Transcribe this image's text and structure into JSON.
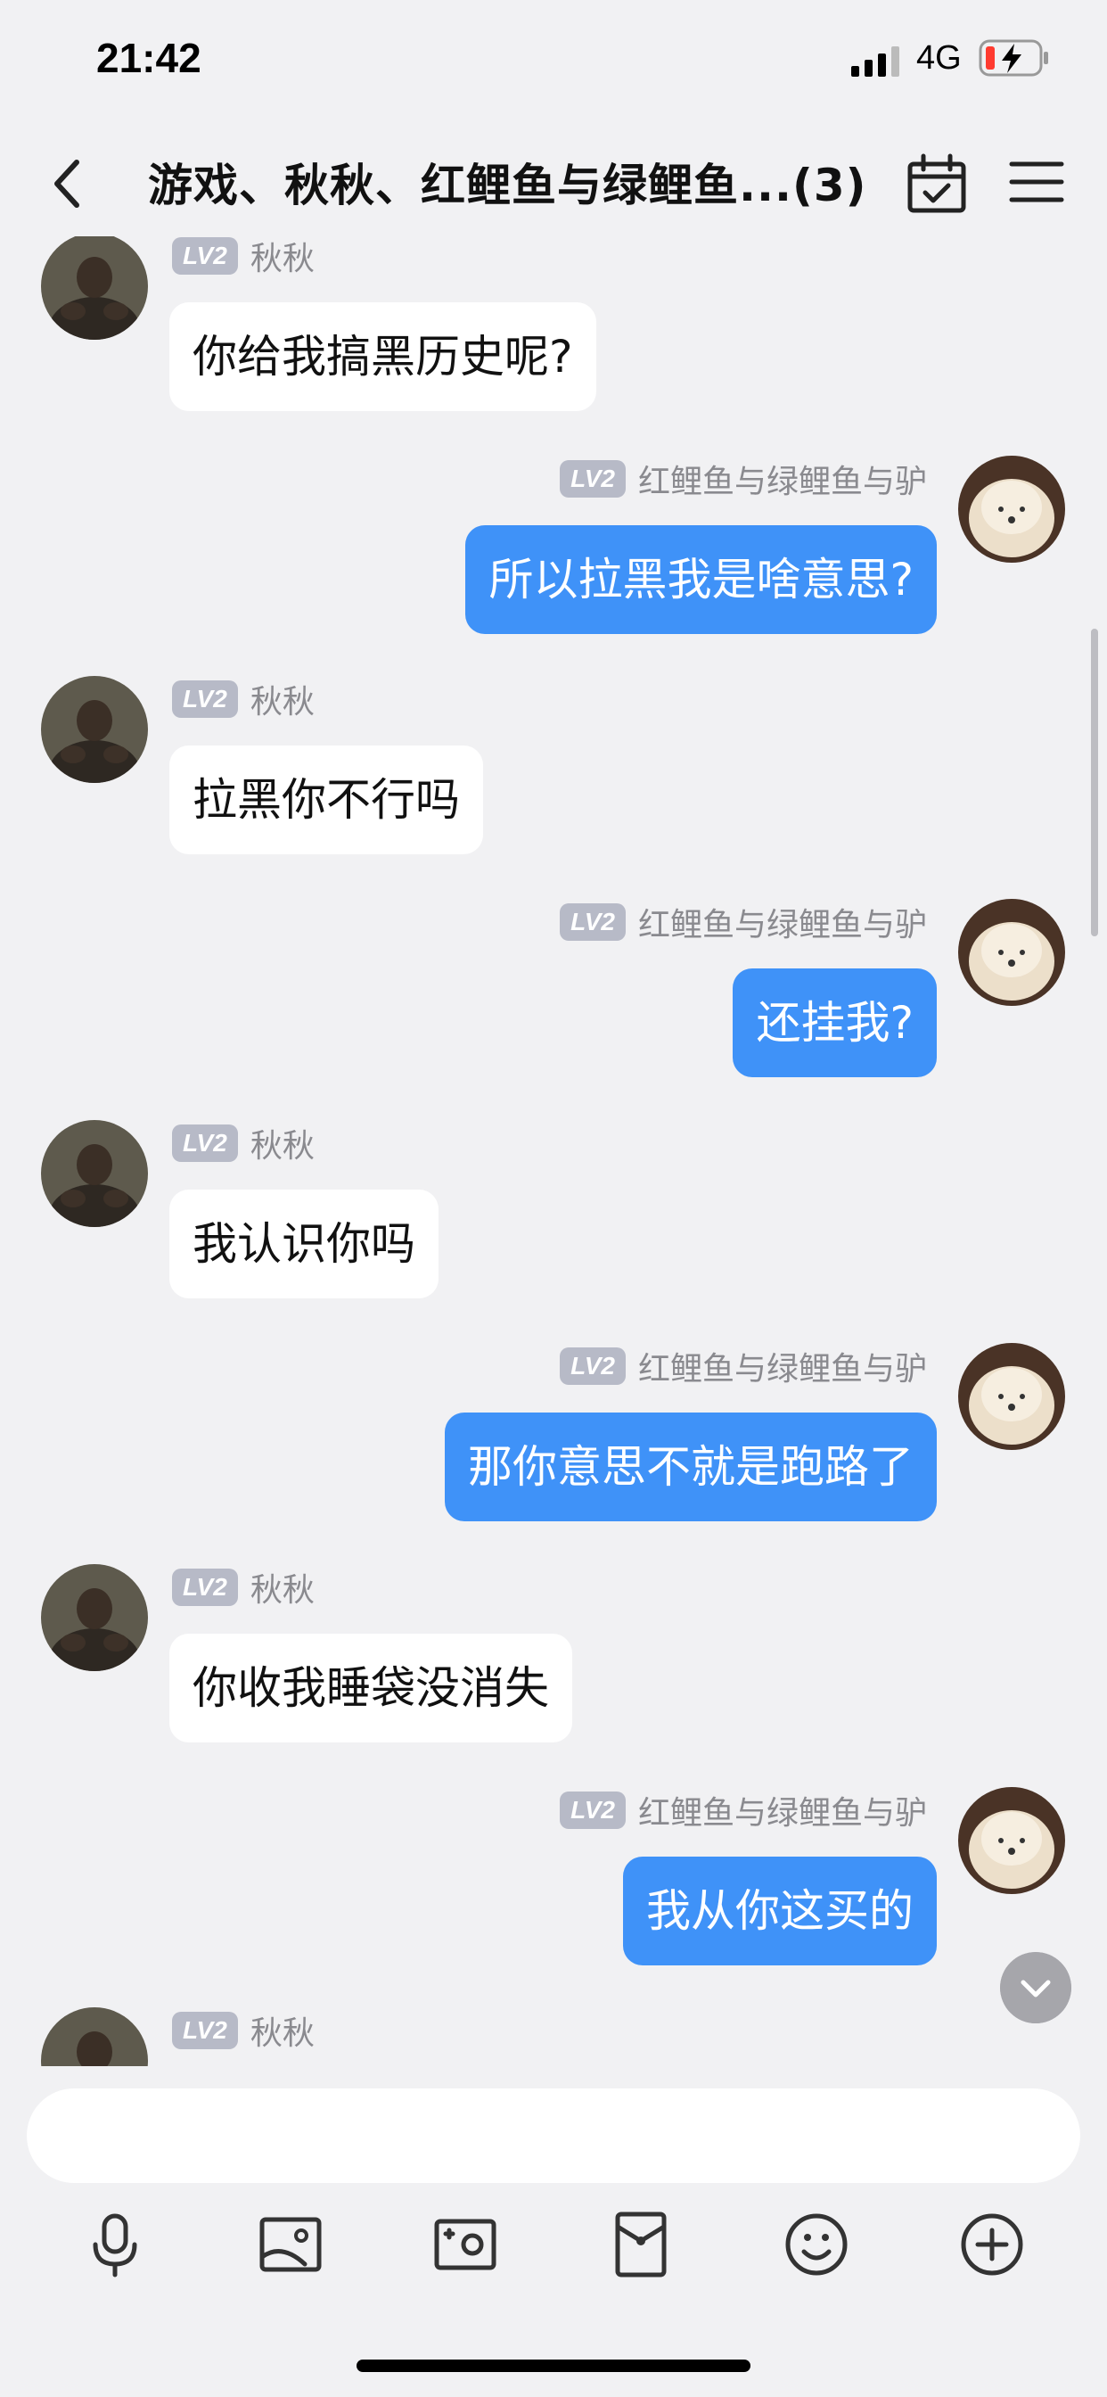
{
  "status_bar": {
    "time": "21:42",
    "network": "4G"
  },
  "header": {
    "title": "游戏、秋秋、红鲤鱼与绿鲤鱼...(3)"
  },
  "messages": [
    {
      "side": "left",
      "level": "LV2",
      "sender": "秋秋",
      "text": "你给我搞黑历史呢?"
    },
    {
      "side": "right",
      "level": "LV2",
      "sender": "红鲤鱼与绿鲤鱼与驴",
      "text": "所以拉黑我是啥意思?"
    },
    {
      "side": "left",
      "level": "LV2",
      "sender": "秋秋",
      "text": "拉黑你不行吗"
    },
    {
      "side": "right",
      "level": "LV2",
      "sender": "红鲤鱼与绿鲤鱼与驴",
      "text": "还挂我?"
    },
    {
      "side": "left",
      "level": "LV2",
      "sender": "秋秋",
      "text": "我认识你吗"
    },
    {
      "side": "right",
      "level": "LV2",
      "sender": "红鲤鱼与绿鲤鱼与驴",
      "text": "那你意思不就是跑路了"
    },
    {
      "side": "left",
      "level": "LV2",
      "sender": "秋秋",
      "text": "你收我睡袋没消失"
    },
    {
      "side": "right",
      "level": "LV2",
      "sender": "红鲤鱼与绿鲤鱼与驴",
      "text": "我从你这买的"
    },
    {
      "side": "left",
      "level": "LV2",
      "sender": "秋秋",
      "text": ""
    }
  ],
  "input": {
    "value": "",
    "placeholder": ""
  },
  "toolbar": [
    "microphone-icon",
    "image-icon",
    "camera-icon",
    "red-packet-icon",
    "emoji-icon",
    "plus-icon"
  ],
  "colors": {
    "outgoing_bubble": "#3f92f8",
    "incoming_bubble": "#ffffff",
    "background": "#f1f1f3",
    "level_badge": "#b7bac7"
  }
}
